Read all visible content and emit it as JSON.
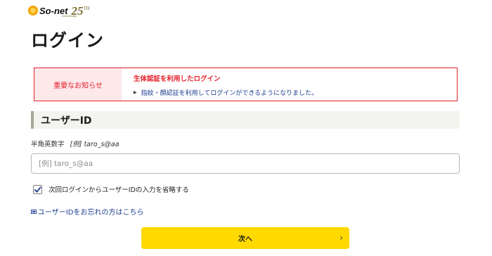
{
  "header": {
    "logo_text": "So-net",
    "anniversary_number": "25",
    "anniversary_suffix": "TH",
    "anniversary_caption": "Anniversary"
  },
  "page": {
    "title": "ログイン"
  },
  "notice": {
    "label": "重要なお知らせ",
    "title": "生体認証を利用したログイン",
    "item": "指紋・顔認証を利用してログインができるようになりました。",
    "accent_color": "#e6202a"
  },
  "user_id_section": {
    "heading": "ユーザーID",
    "hint_label": "半角英数字",
    "hint_example": "[例] taro_s@aa",
    "input_value": "",
    "input_placeholder": "[例] taro_s@aa"
  },
  "remember": {
    "checked": true,
    "label": "次回ログインからユーザーIDの入力を省略する"
  },
  "forgot_link": {
    "icon": "window-icon",
    "text": "ユーザーIDをお忘れの方はこちら"
  },
  "next_button": {
    "label": "次へ",
    "chevron": "›",
    "color": "#ffd900"
  }
}
